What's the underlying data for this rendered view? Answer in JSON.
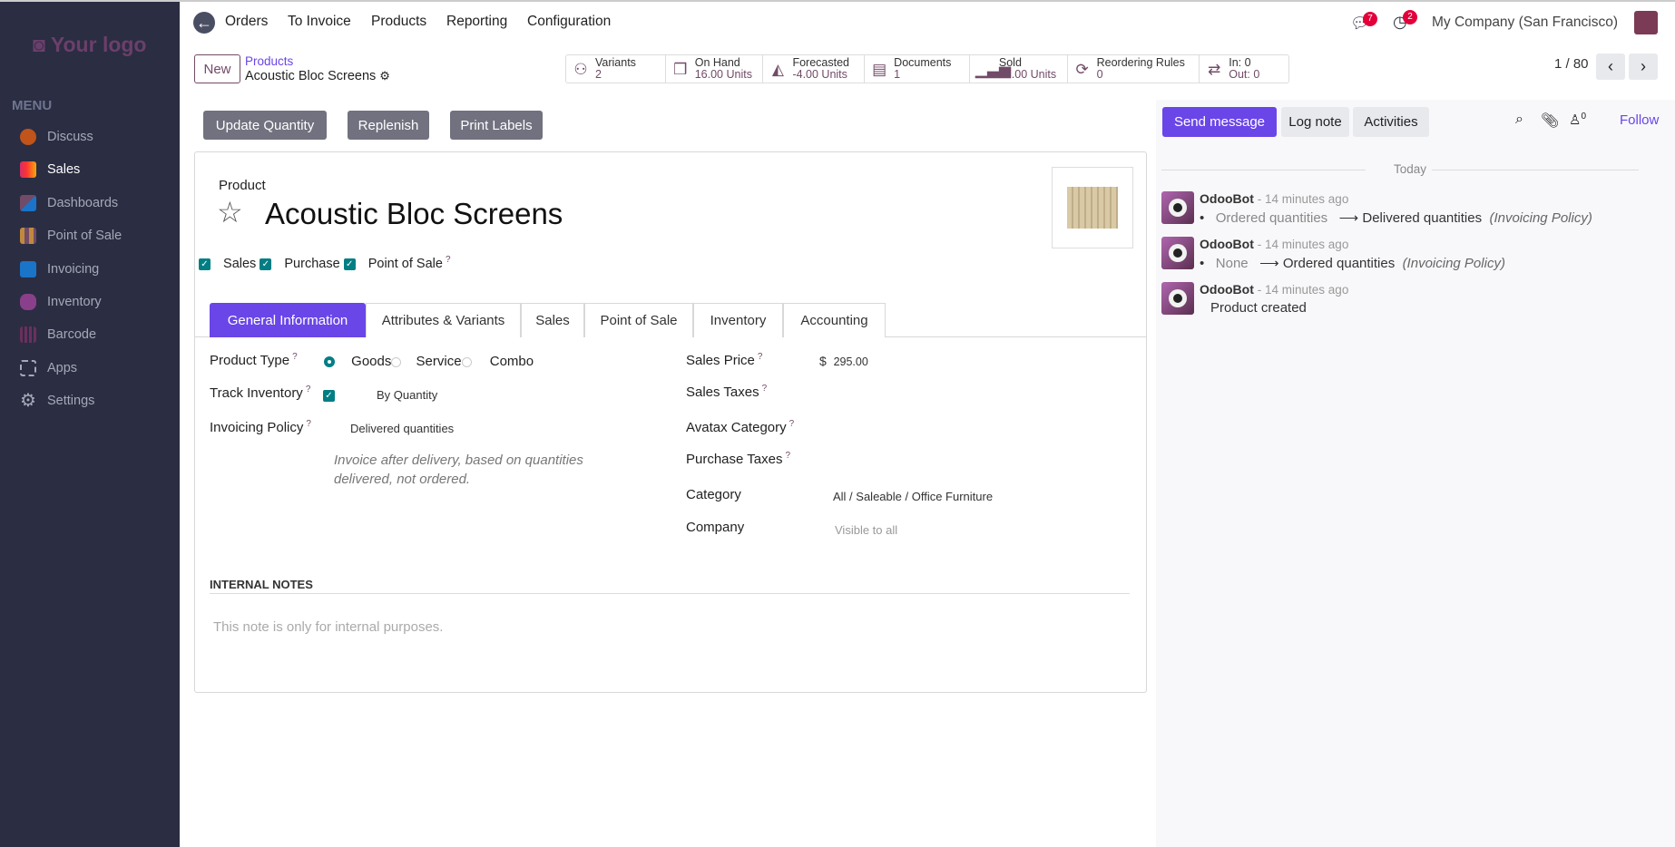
{
  "sidebar": {
    "logo": "Your logo",
    "menu_heading": "MENU",
    "items": [
      {
        "label": "Discuss",
        "color": "#c0541a"
      },
      {
        "label": "Sales",
        "color": "#f7a70a"
      },
      {
        "label": "Dashboards",
        "color": "#714b67"
      },
      {
        "label": "Point of Sale",
        "color": "#c08a3e"
      },
      {
        "label": "Invoicing",
        "color": "#1a74c8"
      },
      {
        "label": "Inventory",
        "color": "#8a3f8a"
      },
      {
        "label": "Barcode",
        "color": "#6b2f5e"
      },
      {
        "label": "Apps",
        "color": "#a5a8b8"
      },
      {
        "label": "Settings",
        "color": "#a5a8b8"
      }
    ]
  },
  "topnav": {
    "items": [
      "Orders",
      "To Invoice",
      "Products",
      "Reporting",
      "Configuration"
    ],
    "messages_count": "7",
    "activities_count": "2",
    "company": "My Company (San Francisco)"
  },
  "control": {
    "new_label": "New",
    "breadcrumb_parent": "Products",
    "breadcrumb_current": "Acoustic Bloc Screens",
    "pager": "1 / 80"
  },
  "stats": [
    {
      "icon": "sitemap-icon",
      "glyph": "⚇",
      "label": "Variants",
      "value": "2"
    },
    {
      "icon": "cubes-icon",
      "glyph": "❒",
      "label": "On Hand",
      "value": "16.00 Units"
    },
    {
      "icon": "area-chart-icon",
      "glyph": "◭",
      "label": "Forecasted",
      "value": "-4.00 Units"
    },
    {
      "icon": "document-icon",
      "glyph": "▤",
      "label": "Documents",
      "value": "1"
    },
    {
      "icon": "signal-icon",
      "glyph": "▁▃▅",
      "label": "Sold",
      "value": "47.00 Units"
    },
    {
      "icon": "refresh-icon",
      "glyph": "⟳",
      "label": "Reordering Rules",
      "value": "0"
    },
    {
      "icon": "exchange-icon",
      "glyph": "⇄",
      "label": "In: 0",
      "value": "Out: 0"
    }
  ],
  "actions": [
    "Update Quantity",
    "Replenish",
    "Print Labels"
  ],
  "form": {
    "product_label": "Product",
    "name": "Acoustic Bloc Screens",
    "checks": [
      "Sales",
      "Purchase",
      "Point of Sale"
    ],
    "tabs": [
      "General Information",
      "Attributes & Variants",
      "Sales",
      "Point of Sale",
      "Inventory",
      "Accounting"
    ],
    "product_type_label": "Product Type",
    "product_type_options": [
      "Goods",
      "Service",
      "Combo"
    ],
    "track_inventory_label": "Track Inventory",
    "track_inventory_value": "By Quantity",
    "invoicing_policy_label": "Invoicing Policy",
    "invoicing_policy_value": "Delivered quantities",
    "invoicing_help": "Invoice after delivery, based on quantities delivered, not ordered.",
    "sales_price_label": "Sales Price",
    "currency": "$",
    "sales_price": "295.00",
    "sales_taxes_label": "Sales Taxes",
    "avatax_label": "Avatax Category",
    "purchase_taxes_label": "Purchase Taxes",
    "category_label": "Category",
    "category_value": "All / Saleable / Office Furniture",
    "company_label": "Company",
    "company_placeholder": "Visible to all",
    "notes_heading": "INTERNAL NOTES",
    "notes_placeholder": "This note is only for internal purposes."
  },
  "chatter": {
    "send_message": "Send message",
    "log_note": "Log note",
    "activities": "Activities",
    "followers_count": "0",
    "follow": "Follow",
    "date_sep": "Today",
    "messages": [
      {
        "author": "OdooBot",
        "time": "- 14 minutes ago",
        "old": "Ordered quantities",
        "new": "Delivered quantities",
        "field": "(Invoicing Policy)"
      },
      {
        "author": "OdooBot",
        "time": "- 14 minutes ago",
        "old": "None",
        "new": "Ordered quantities",
        "field": "(Invoicing Policy)"
      },
      {
        "author": "OdooBot",
        "time": "- 14 minutes ago",
        "text": "Product created"
      }
    ]
  }
}
